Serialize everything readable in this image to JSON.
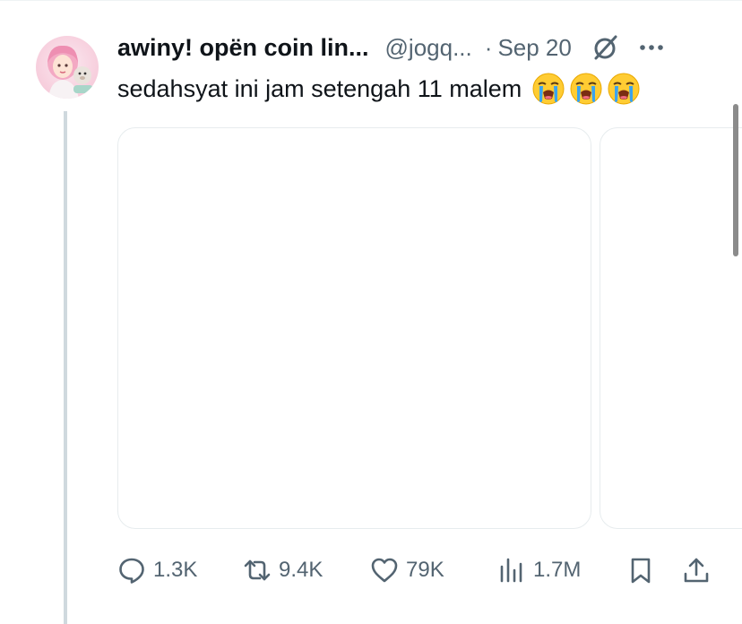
{
  "tweet": {
    "author_name": "awiny! opën coin lin...",
    "handle": "@jogq...",
    "separator": "·",
    "date": "Sep 20",
    "text": "sedahsyat ini jam setengah 11 malem",
    "emoji_icon": "loudly-crying-face-icon"
  },
  "actions": {
    "replies": "1.3K",
    "reposts": "9.4K",
    "likes": "79K",
    "views": "1.7M"
  },
  "colors": {
    "text_primary": "#0f1419",
    "text_secondary": "#536471",
    "thread_line": "#cfd9de",
    "media_border": "#e7ecee"
  }
}
